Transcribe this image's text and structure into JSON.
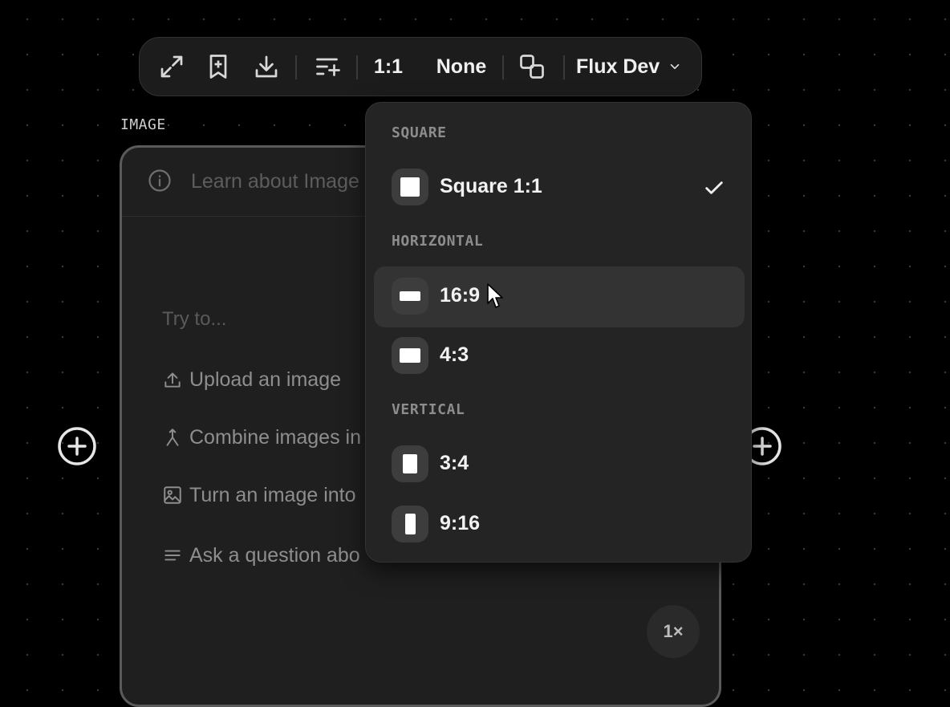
{
  "toolbar": {
    "expand_icon": "expand-arrows-icon",
    "bookmark_icon": "bookmark-plus-icon",
    "download_icon": "download-icon",
    "prompt_icon": "list-sparkle-icon",
    "aspect_ratio": "1:1",
    "style": "None",
    "compare_icon": "copy-squares-icon",
    "model": "Flux Dev",
    "model_chevron": "chevron-down-icon"
  },
  "node": {
    "title": "IMAGE",
    "learn_text": "Learn about Image",
    "try_text": "Try to...",
    "suggestions": [
      {
        "label": "Upload an image",
        "icon": "upload-icon"
      },
      {
        "label": "Combine images in",
        "icon": "merge-icon"
      },
      {
        "label": "Turn an image into",
        "icon": "image-icon"
      },
      {
        "label": "Ask a question abo",
        "icon": "text-lines-icon"
      }
    ],
    "zoom": "1×"
  },
  "dropdown": {
    "sections": [
      {
        "label": "SQUARE",
        "items": [
          {
            "label": "Square 1:1",
            "selected": true
          }
        ]
      },
      {
        "label": "HORIZONTAL",
        "items": [
          {
            "label": "16:9",
            "selected": false,
            "hovered": true
          },
          {
            "label": "4:3",
            "selected": false
          }
        ]
      },
      {
        "label": "VERTICAL",
        "items": [
          {
            "label": "3:4",
            "selected": false
          },
          {
            "label": "9:16",
            "selected": false
          }
        ]
      }
    ]
  },
  "colors": {
    "background": "#000000",
    "panel": "#242424",
    "hover": "#333333",
    "text": "#f2f2f2",
    "muted": "#8d8d8d"
  }
}
